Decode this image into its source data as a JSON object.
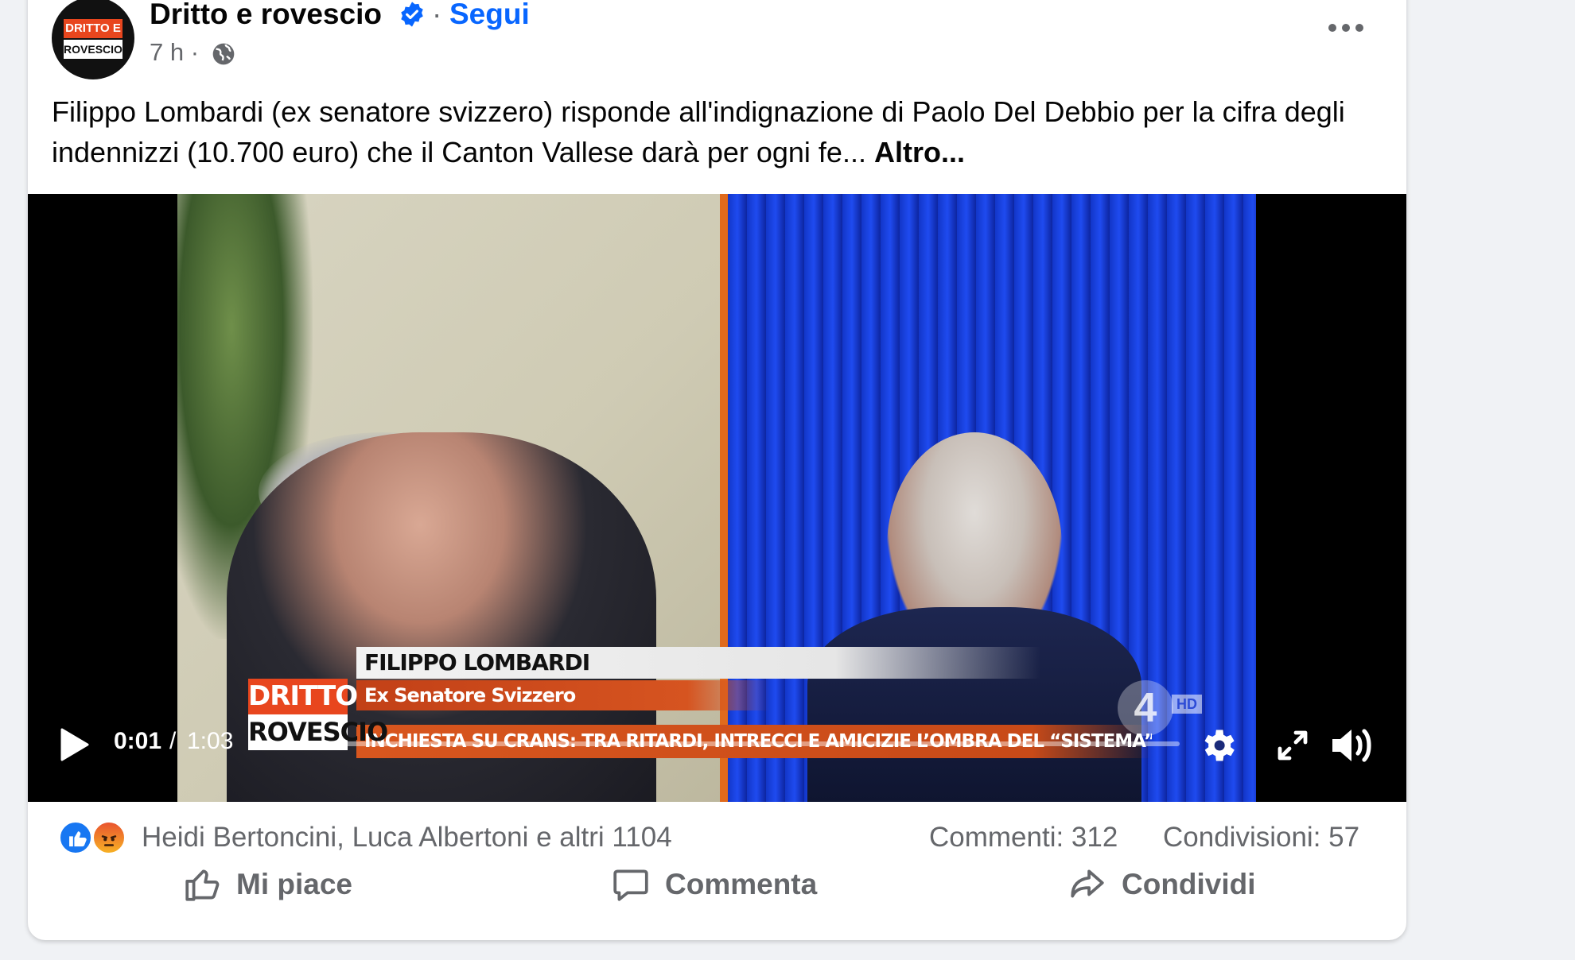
{
  "post": {
    "author": "Dritto e rovescio",
    "separator": "·",
    "follow_label": "Segui",
    "time": "7 h ·",
    "text": "Filippo Lombardi (ex senatore svizzero) risponde all'indignazione di Paolo Del Debbio per la cifra degli indennizzi (10.700 euro) che il Canton Vallese darà per ogni fe...",
    "more_label": "Altro..."
  },
  "avatar": {
    "logo_top": "DRITTO E",
    "logo_bottom": "ROVESCIO"
  },
  "video": {
    "overlay_logo_top": "DRITTO E",
    "overlay_logo_bottom": "ROVESCIO",
    "caption_name": "FILIPPO LOMBARDI",
    "caption_role": "Ex Senatore Svizzero",
    "caption_headline": "INCHIESTA SU CRANS: TRA RITARDI, INTRECCI E AMICIZIE L’OMBRA DEL “SISTEMA”",
    "channel_number": "4",
    "channel_hd": "HD",
    "current_time": "0:01",
    "time_separator": "/",
    "duration": "1:03",
    "progress_fraction": 0.016
  },
  "engagement": {
    "reactors": "Heidi Bertoncini, Luca Albertoni e altri 1104",
    "comments": "Commenti: 312",
    "shares": "Condivisioni: 57"
  },
  "actions": {
    "like": "Mi piace",
    "comment": "Commenta",
    "share": "Condividi"
  },
  "colors": {
    "accent": "#0866ff",
    "secondary_text": "#65676b",
    "overlay_orange": "#e8461e"
  },
  "icons": [
    "verified-icon",
    "globe-icon",
    "more-icon",
    "play-icon",
    "settings-icon",
    "fullscreen-icon",
    "volume-icon",
    "like-reaction-icon",
    "angry-reaction-icon",
    "thumbs-up-icon",
    "comment-icon",
    "share-icon"
  ]
}
